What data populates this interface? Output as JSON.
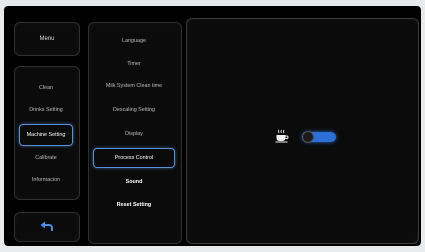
{
  "menu": {
    "label": "Menu"
  },
  "categories": [
    {
      "label": "Clean"
    },
    {
      "label": "Drinks Setting"
    },
    {
      "label": "Machine Setting"
    },
    {
      "label": "Calibrate"
    },
    {
      "label": "Informacion"
    }
  ],
  "selected_category": "Machine Setting",
  "submenu": [
    {
      "label": "Language"
    },
    {
      "label": "Timer"
    },
    {
      "label": "Milk System Clean time"
    },
    {
      "label": "Descaling Setting"
    },
    {
      "label": "Display"
    },
    {
      "label": "Process Control"
    },
    {
      "label": "Sound"
    },
    {
      "label": "Reset Setting"
    }
  ],
  "selected_submenu": "Process Control",
  "content": {
    "icon": "coffee-cup-icon",
    "toggle_on": true,
    "accent_color": "#2c6fd6"
  },
  "back": {
    "icon": "back-arrow-icon"
  }
}
